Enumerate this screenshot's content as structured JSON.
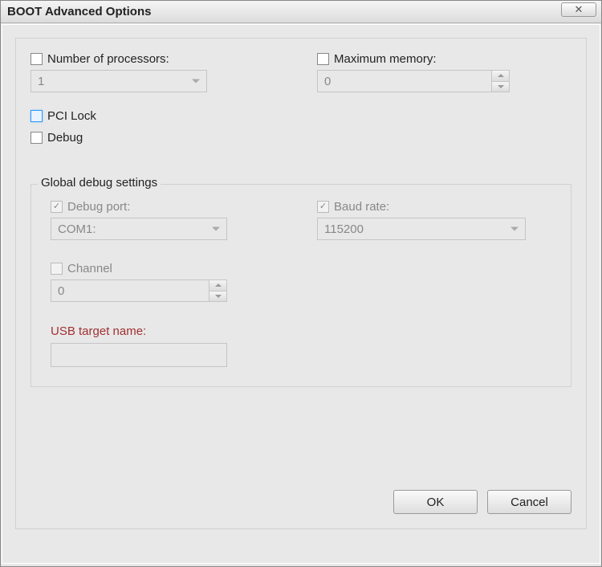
{
  "window": {
    "title": "BOOT Advanced Options"
  },
  "main": {
    "numProcessors": {
      "label": "Number of processors:",
      "value": "1",
      "checked": false
    },
    "maxMemory": {
      "label": "Maximum memory:",
      "value": "0",
      "checked": false
    },
    "pciLock": {
      "label": "PCI Lock",
      "checked": false
    },
    "debug": {
      "label": "Debug",
      "checked": false
    }
  },
  "globalDebug": {
    "legend": "Global debug settings",
    "debugPort": {
      "label": "Debug port:",
      "value": "COM1:",
      "checked": true
    },
    "baudRate": {
      "label": "Baud rate:",
      "value": "115200",
      "checked": true
    },
    "channel": {
      "label": "Channel",
      "value": "0",
      "checked": false
    },
    "usbTarget": {
      "label": "USB target name:",
      "value": ""
    }
  },
  "buttons": {
    "ok": "OK",
    "cancel": "Cancel"
  }
}
